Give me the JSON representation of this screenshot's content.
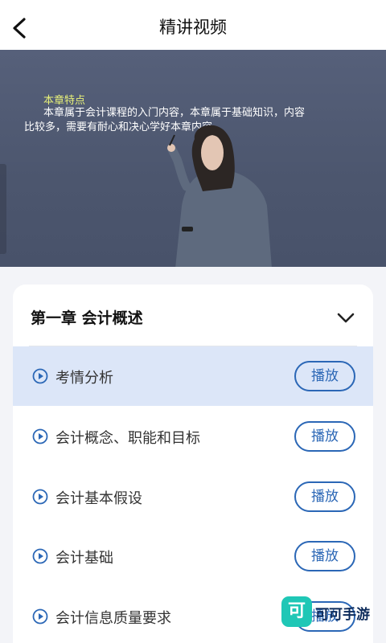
{
  "header": {
    "title": "精讲视频",
    "back_icon": "back-arrow-icon"
  },
  "video": {
    "slide_title": "本章特点",
    "slide_body": "本章属于会计课程的入门内容，本章属于基础知识，内容比较多，需要有耐心和决心学好本章内容。"
  },
  "chapter": {
    "title": "第一章 会计概述",
    "expanded": true
  },
  "lessons": [
    {
      "title": "考情分析",
      "button": "播放",
      "active": true
    },
    {
      "title": "会计概念、职能和目标",
      "button": "播放",
      "active": false
    },
    {
      "title": "会计基本假设",
      "button": "播放",
      "active": false
    },
    {
      "title": "会计基础",
      "button": "播放",
      "active": false
    },
    {
      "title": "会计信息质量要求",
      "button": "播放",
      "active": false
    }
  ],
  "watermark": {
    "logo_char": "可",
    "text": "可可手游"
  },
  "colors": {
    "accent": "#2b67b6",
    "active_row": "#dce6f8",
    "slide_title": "#e8f178",
    "watermark_logo": "#1fc7b6"
  }
}
